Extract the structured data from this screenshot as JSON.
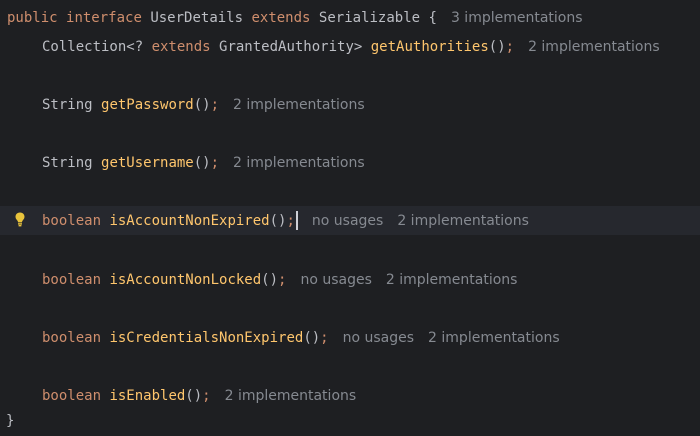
{
  "editor": {
    "header": {
      "kw_public": "public",
      "kw_interface": "interface",
      "class_name": "UserDetails",
      "kw_extends": "extends",
      "super_name": "Serializable",
      "open_brace": "{",
      "hint": "3 implementations"
    },
    "lines": [
      {
        "type_prefix": "Collection<? ",
        "type_kw": "extends",
        "type_suffix": " GrantedAuthority> ",
        "method": "getAuthorities",
        "parens": "()",
        "semi": ";",
        "usages": "",
        "impl": "2 implementations"
      },
      {
        "type": "String ",
        "method": "getPassword",
        "parens": "()",
        "semi": ";",
        "usages": "",
        "impl": "2 implementations"
      },
      {
        "type": "String ",
        "method": "getUsername",
        "parens": "()",
        "semi": ";",
        "usages": "",
        "impl": "2 implementations"
      },
      {
        "type": "boolean ",
        "method": "isAccountNonExpired",
        "parens": "()",
        "semi": ";",
        "usages": "no usages",
        "impl": "2 implementations"
      },
      {
        "type": "boolean ",
        "method": "isAccountNonLocked",
        "parens": "()",
        "semi": ";",
        "usages": "no usages",
        "impl": "2 implementations"
      },
      {
        "type": "boolean ",
        "method": "isCredentialsNonExpired",
        "parens": "()",
        "semi": ";",
        "usages": "no usages",
        "impl": "2 implementations"
      },
      {
        "type": "boolean ",
        "method": "isEnabled",
        "parens": "()",
        "semi": ";",
        "usages": "",
        "impl": "2 implementations"
      }
    ],
    "close_brace": "}",
    "gutter_icon": "lightbulb-icon",
    "colors": {
      "background": "#1e1f22",
      "current_line": "#26282e",
      "keyword": "#cf8e6d",
      "method": "#ffc66d",
      "hint": "#868a91",
      "bulb": "#e8c33c"
    }
  }
}
